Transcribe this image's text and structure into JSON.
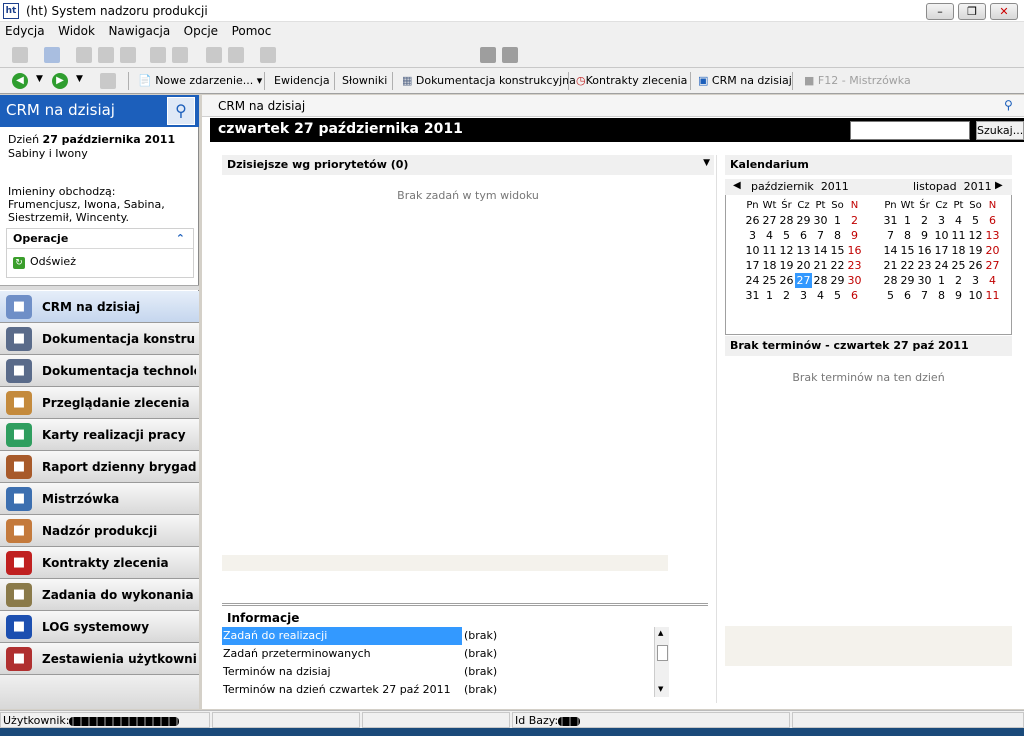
{
  "window": {
    "title": "(ht) System nadzoru produkcji",
    "icon": "app-icon",
    "minimize": "0",
    "maximize": "1",
    "close": "r"
  },
  "menu": [
    "Edycja",
    "Widok",
    "Nawigacja",
    "Opcje",
    "Pomoc"
  ],
  "toolbar2": {
    "new_event": "Nowe zdarzenie...",
    "evidence": "Ewidencja",
    "dictionaries": "Słowniki",
    "construction_docs": "Dokumentacja konstrukcyjna",
    "order_contracts": "Kontrakty zlecenia",
    "crm_today": "CRM na dzisiaj",
    "f12": "F12 - Mistrzówka"
  },
  "sidebar": {
    "title": "CRM na dzisiaj",
    "day_prefix": "Dzień",
    "date": "27 października 2011",
    "names": "Sabiny i Iwony",
    "nameday_label": "Imieniny obchodzą:",
    "nameday_list": "Frumencjusz, Iwona, Sabina,",
    "nameday_list2": "Siestrzemił, Wincenty.",
    "operations_title": "Operacje",
    "refresh": "Odśwież",
    "nav": [
      {
        "label": "CRM na dzisiaj",
        "icon": "crm-magnifier-icon",
        "color": "#6f8fc7"
      },
      {
        "label": "Dokumentacja konstrukcyjna",
        "icon": "document-building-icon",
        "color": "#5a6b8a"
      },
      {
        "label": "Dokumentacja technologiczna",
        "icon": "document-building-icon",
        "color": "#5a6b8a"
      },
      {
        "label": "Przeglądanie zlecenia",
        "icon": "magnifier-icon",
        "color": "#c48a3c"
      },
      {
        "label": "Karty realizacji pracy",
        "icon": "work-card-icon",
        "color": "#2f9e5f"
      },
      {
        "label": "Raport dzienny brygad",
        "icon": "people-icon",
        "color": "#a85a2a"
      },
      {
        "label": "Mistrzówka",
        "icon": "foreman-icon",
        "color": "#3c6fb0"
      },
      {
        "label": "Nadzór produkcji",
        "icon": "person-icon",
        "color": "#c47a3c"
      },
      {
        "label": "Kontrakty zlecenia",
        "icon": "contract-clock-icon",
        "color": "#c02020"
      },
      {
        "label": "Zadania do wykonania",
        "icon": "checklist-icon",
        "color": "#8a7a4a"
      },
      {
        "label": "LOG systemowy",
        "icon": "info-icon",
        "color": "#1c4fb0"
      },
      {
        "label": "Zestawienia użytkownika",
        "icon": "report-icon",
        "color": "#b03030"
      }
    ]
  },
  "content": {
    "header": "CRM na dzisiaj",
    "date_bar": "czwartek 27 października 2011",
    "search_button": "Szukaj...",
    "search_value": "",
    "priorities_title": "Dzisiejsze wg priorytetów (0)",
    "priorities_empty": "Brak zadań w tym widoku",
    "info_title": "Informacje",
    "info_rows": [
      {
        "key": "Zadań do realizacji",
        "value": "(brak)"
      },
      {
        "key": "Zadań przeterminowanych",
        "value": "(brak)"
      },
      {
        "key": "Terminów na dzisiaj",
        "value": "(brak)"
      },
      {
        "key": "Terminów na dzień czwartek 27 paź 2011",
        "value": "(brak)"
      }
    ],
    "calendar_title": "Kalendarium",
    "calendar": {
      "months": [
        {
          "name": "październik",
          "year": "2011"
        },
        {
          "name": "listopad",
          "year": "2011"
        }
      ],
      "weekdays": [
        "Pn",
        "Wt",
        "Śr",
        "Cz",
        "Pt",
        "So",
        "N"
      ],
      "october": [
        [
          "26",
          "27",
          "28",
          "29",
          "30",
          "1",
          "2"
        ],
        [
          "3",
          "4",
          "5",
          "6",
          "7",
          "8",
          "9"
        ],
        [
          "10",
          "11",
          "12",
          "13",
          "14",
          "15",
          "16"
        ],
        [
          "17",
          "18",
          "19",
          "20",
          "21",
          "22",
          "23"
        ],
        [
          "24",
          "25",
          "26",
          "27",
          "28",
          "29",
          "30"
        ],
        [
          "31",
          "1",
          "2",
          "3",
          "4",
          "5",
          "6"
        ]
      ],
      "november": [
        [
          "31",
          "1",
          "2",
          "3",
          "4",
          "5",
          "6"
        ],
        [
          "7",
          "8",
          "9",
          "10",
          "11",
          "12",
          "13"
        ],
        [
          "14",
          "15",
          "16",
          "17",
          "18",
          "19",
          "20"
        ],
        [
          "21",
          "22",
          "23",
          "24",
          "25",
          "26",
          "27"
        ],
        [
          "28",
          "29",
          "30",
          "1",
          "2",
          "3",
          "4"
        ],
        [
          "5",
          "6",
          "7",
          "8",
          "9",
          "10",
          "11"
        ]
      ],
      "today": "27"
    },
    "no_terms_title": "Brak terminów - czwartek 27 paź 2011",
    "no_terms_empty": "Brak terminów na ten dzień"
  },
  "status": {
    "user_label": "Użytkownik:",
    "db_label": "Id Bazy:"
  }
}
